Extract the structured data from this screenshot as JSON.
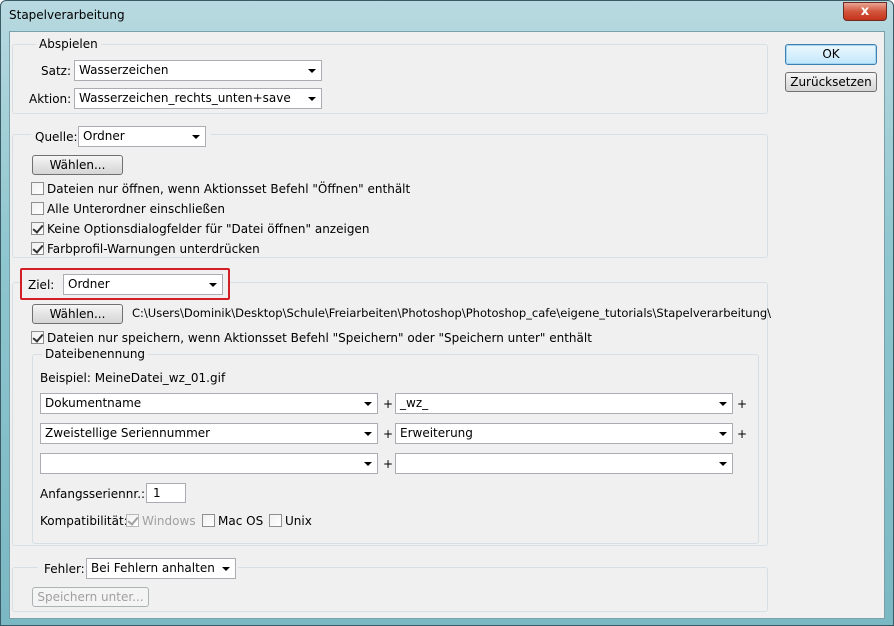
{
  "window": {
    "title": "Stapelverarbeitung",
    "close_glyph": "x"
  },
  "buttons": {
    "ok": "OK",
    "reset": "Zurücksetzen"
  },
  "abspielen": {
    "legend": "Abspielen",
    "satz_label": "Satz:",
    "satz_value": "Wasserzeichen",
    "aktion_label": "Aktion:",
    "aktion_value": "Wasserzeichen_rechts_unten+save"
  },
  "quelle": {
    "label": "Quelle:",
    "value": "Ordner",
    "choose_button": "Wählen...",
    "options": [
      {
        "label": "Dateien nur öffnen, wenn Aktionsset Befehl \"Öffnen\" enthält",
        "checked": false
      },
      {
        "label": "Alle Unterordner einschließen",
        "checked": false
      },
      {
        "label": "Keine Optionsdialogfelder für \"Datei öffnen\" anzeigen",
        "checked": true
      },
      {
        "label": "Farbprofil-Warnungen unterdrücken",
        "checked": true
      }
    ]
  },
  "ziel": {
    "label": "Ziel:",
    "value": "Ordner",
    "choose_button": "Wählen...",
    "path": "C:\\Users\\Dominik\\Desktop\\Schule\\Freiarbeiten\\Photoshop\\Photoshop_cafe\\eigene_tutorials\\Stapelverarbeitung\\",
    "save_option": {
      "label": "Dateien nur speichern, wenn Aktionsset Befehl \"Speichern\" oder \"Speichern unter\" enthält",
      "checked": true
    }
  },
  "dateibenennung": {
    "legend": "Dateibenennung",
    "example": "Beispiel: MeineDatei_wz_01.gif",
    "rows": [
      {
        "left": "Dokumentname",
        "right": "_wz_"
      },
      {
        "left": "Zweistellige Seriennummer",
        "right": "Erweiterung"
      },
      {
        "left": "",
        "right": ""
      }
    ],
    "plus": "+",
    "start_label": "Anfangsseriennr.:",
    "start_value": "1",
    "compat_label": "Kompatibilität:",
    "compat": [
      {
        "label": "Windows",
        "checked": true,
        "disabled": true
      },
      {
        "label": "Mac OS",
        "checked": false,
        "disabled": false
      },
      {
        "label": "Unix",
        "checked": false,
        "disabled": false
      }
    ]
  },
  "fehler": {
    "label": "Fehler:",
    "value": "Bei Fehlern anhalten",
    "save_button": "Speichern unter..."
  },
  "colors": {
    "highlight": "#d21f25",
    "group_border": "#d5dfe5",
    "dialog_bg": "#f0f0f0"
  }
}
